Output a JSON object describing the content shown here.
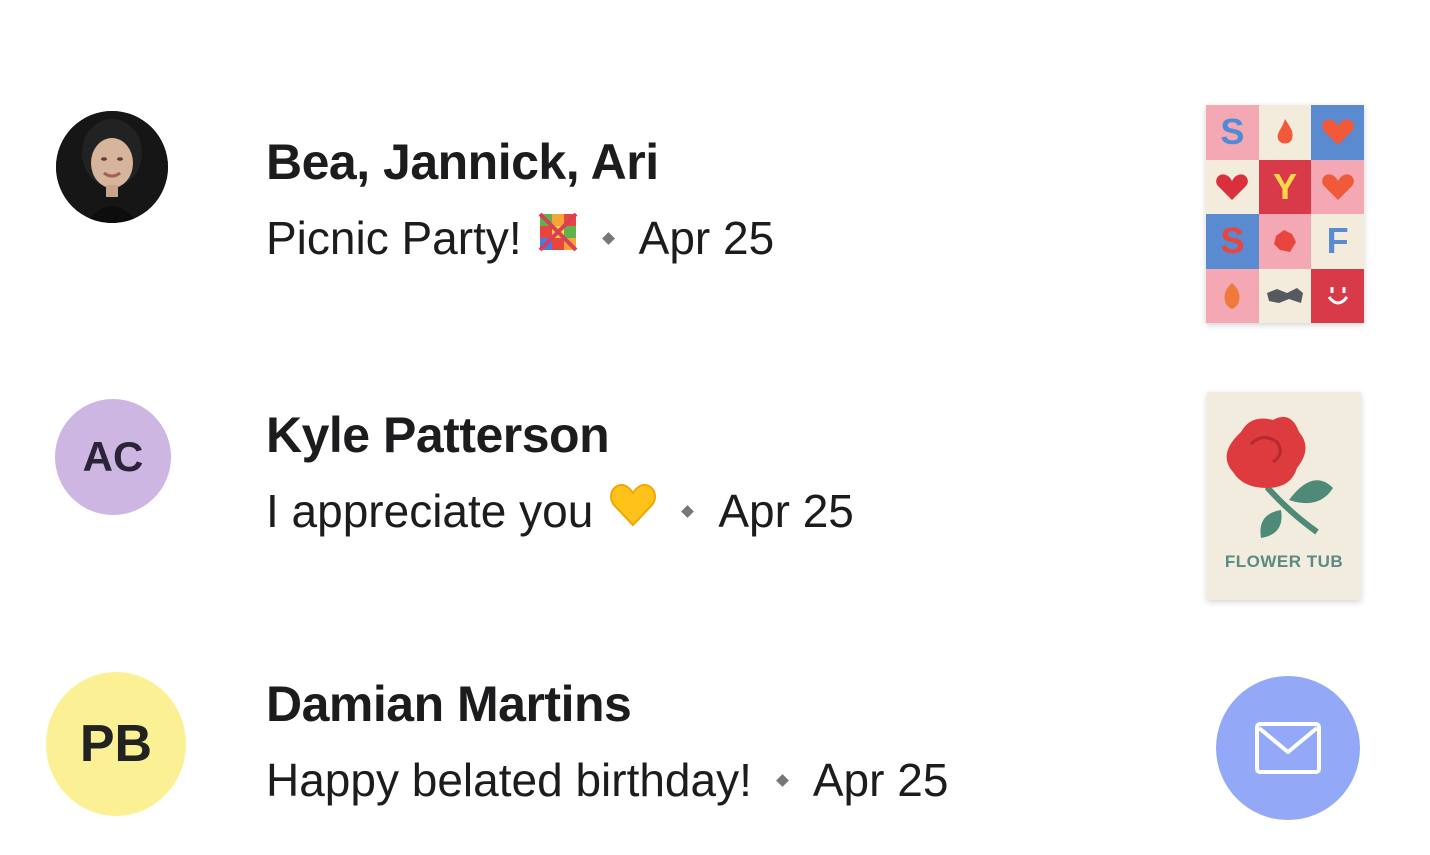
{
  "conversations": [
    {
      "name": "Bea, Jannick, Ari",
      "message": "Picnic Party!",
      "emoji": "flag-mosaic",
      "date": "Apr 25",
      "avatar": {
        "type": "photo"
      },
      "thumbnail": {
        "type": "card",
        "letters": [
          "S",
          "Y",
          "F",
          "S"
        ]
      }
    },
    {
      "name": "Kyle Patterson",
      "message": "I appreciate you",
      "emoji": "yellow-heart",
      "date": "Apr 25",
      "avatar": {
        "type": "initials",
        "initials": "AC",
        "color": "#cdb6e2"
      },
      "thumbnail": {
        "type": "card",
        "label": "FLOWER TUB"
      }
    },
    {
      "name": "Damian Martins",
      "message": "Happy belated birthday!",
      "date": "Apr 25",
      "avatar": {
        "type": "initials",
        "initials": "PB",
        "color": "#fbf094"
      },
      "thumbnail": {
        "type": "envelope-button",
        "icon": "envelope-icon",
        "color": "#93a8f7"
      }
    }
  ],
  "separator_icon": "diamond-icon"
}
